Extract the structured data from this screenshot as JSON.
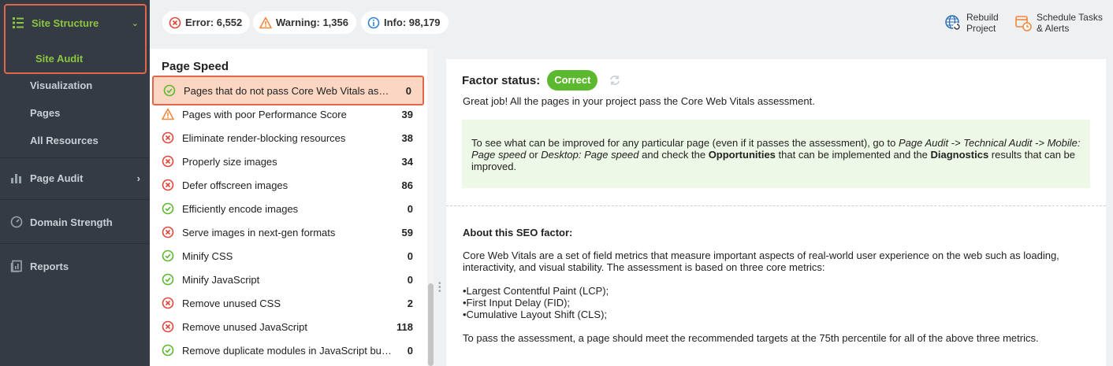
{
  "sidebar": {
    "site_structure": {
      "label": "Site Structure",
      "chevron": "⌄"
    },
    "site_audit": "Site Audit",
    "visualization": "Visualization",
    "pages": "Pages",
    "all_resources": "All Resources",
    "page_audit": {
      "label": "Page Audit",
      "chevron": "›"
    },
    "domain_strength": "Domain Strength",
    "reports": "Reports"
  },
  "topbar": {
    "error": "Error: 6,552",
    "warning": "Warning: 1,356",
    "info": "Info: 98,179",
    "rebuild": {
      "line1": "Rebuild",
      "line2": "Project"
    },
    "schedule": {
      "line1": "Schedule Tasks",
      "line2": "& Alerts"
    }
  },
  "list": {
    "title": "Page Speed",
    "rows": [
      {
        "label": "Pages that do not pass Core Web Vitals assess...",
        "count": "0",
        "status": "ok"
      },
      {
        "label": "Pages with poor Performance Score",
        "count": "39",
        "status": "warning"
      },
      {
        "label": "Eliminate render-blocking resources",
        "count": "38",
        "status": "error"
      },
      {
        "label": "Properly size images",
        "count": "34",
        "status": "error"
      },
      {
        "label": "Defer offscreen images",
        "count": "86",
        "status": "error"
      },
      {
        "label": "Efficiently encode images",
        "count": "0",
        "status": "ok"
      },
      {
        "label": "Serve images in next-gen formats",
        "count": "59",
        "status": "error"
      },
      {
        "label": "Minify CSS",
        "count": "0",
        "status": "ok"
      },
      {
        "label": "Minify JavaScript",
        "count": "0",
        "status": "ok"
      },
      {
        "label": "Remove unused CSS",
        "count": "2",
        "status": "error"
      },
      {
        "label": "Remove unused JavaScript",
        "count": "118",
        "status": "error"
      },
      {
        "label": "Remove duplicate modules in JavaScript bundles",
        "count": "0",
        "status": "ok"
      }
    ]
  },
  "detail": {
    "factor_label": "Factor status:",
    "factor_badge": "Correct",
    "summary": "Great job! All the pages in your project pass the Core Web Vitals assessment.",
    "tip": {
      "t1": "To see what can be improved for any particular page (even if it passes the assessment), go to ",
      "e1": "Page Audit -> Technical Audit -> Mobile: Page speed",
      "t2": " or ",
      "e2": "Desktop: Page speed",
      "t3": " and check the ",
      "b1": "Opportunities",
      "t4": " that can be implemented and the ",
      "b2": "Diagnostics",
      "t5": " results that can be improved."
    },
    "about_title": "About this SEO factor:",
    "about_text": "Core Web Vitals are a set of field metrics that measure important aspects of real-world user experience on the web such as loading, interactivity, and visual stability. The assessment is based on three core metrics:",
    "bullets": [
      "•Largest Contentful Paint (LCP);",
      "•First Input Delay (FID);",
      "•Cumulative Layout Shift (CLS);"
    ],
    "conclusion": "To pass the assessment, a page should meet the recommended targets at the 75th percentile for all of the above three metrics."
  },
  "colors": {
    "green": "#8dc63f",
    "ok": "#5cb82f",
    "error": "#e0463a",
    "warning": "#f0883a",
    "info": "#2f7fd8",
    "highlight": "#fbd7c3",
    "highlight_border": "#e2674a"
  }
}
